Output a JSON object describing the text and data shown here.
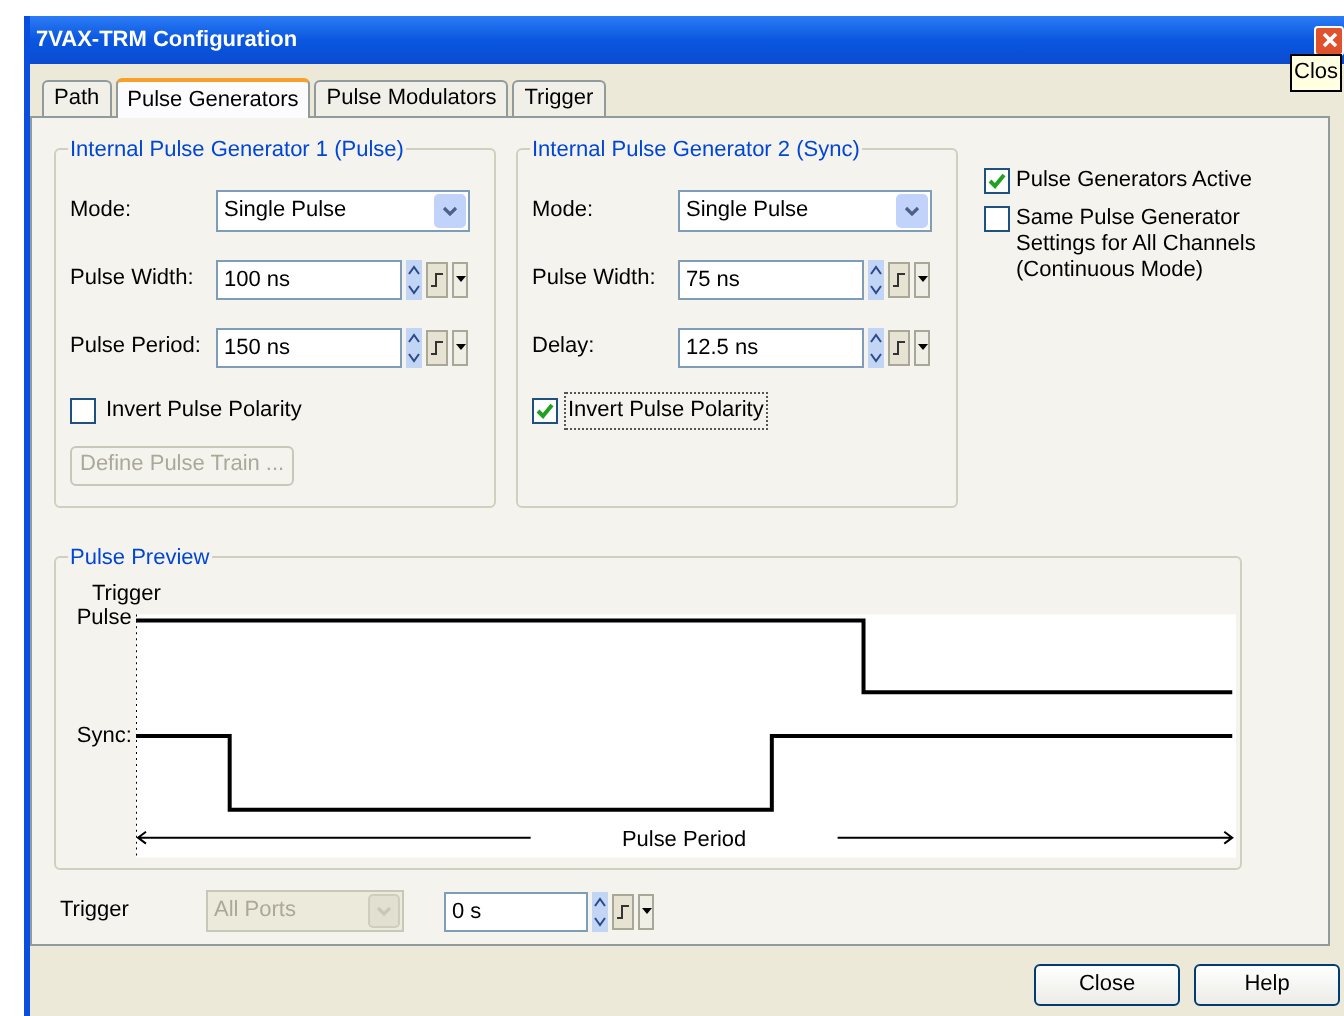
{
  "window": {
    "title": "7VAX-TRM Configuration",
    "close_tooltip": "Clos"
  },
  "tabs": [
    {
      "label": "Path",
      "selected": false
    },
    {
      "label": "Pulse Generators",
      "selected": true
    },
    {
      "label": "Pulse Modulators",
      "selected": false
    },
    {
      "label": "Trigger",
      "selected": false
    }
  ],
  "generators": [
    {
      "title": "Internal Pulse Generator 1 (Pulse)",
      "fields": [
        {
          "kind": "select",
          "label": "Mode:",
          "value": "Single Pulse"
        },
        {
          "kind": "spin",
          "label": "Pulse Width:",
          "value": "100 ns"
        },
        {
          "kind": "spin",
          "label": "Pulse Period:",
          "value": "150 ns"
        }
      ],
      "invert": {
        "label": "Invert Pulse Polarity",
        "checked": false,
        "focused": false
      },
      "button": {
        "label": "Define Pulse Train ...",
        "disabled": true
      }
    },
    {
      "title": "Internal Pulse Generator 2 (Sync)",
      "fields": [
        {
          "kind": "select",
          "label": "Mode:",
          "value": "Single Pulse"
        },
        {
          "kind": "spin",
          "label": "Pulse Width:",
          "value": "75 ns"
        },
        {
          "kind": "spin",
          "label": "Delay:",
          "value": "12.5 ns"
        }
      ],
      "invert": {
        "label": "Invert Pulse Polarity",
        "checked": true,
        "focused": true
      }
    }
  ],
  "options": [
    {
      "label": "Pulse Generators Active",
      "checked": true
    },
    {
      "label": "Same Pulse Generator Settings for All Channels (Continuous Mode)",
      "checked": false
    }
  ],
  "preview": {
    "title": "Pulse Preview",
    "trigger_label": "Trigger",
    "pulse_label": "Pulse",
    "sync_label": "Sync:",
    "period_label": "Pulse Period"
  },
  "trigger": {
    "label": "Trigger",
    "source": {
      "value": "All Ports",
      "disabled": true
    },
    "delay": "0 s"
  },
  "buttons": [
    "Close",
    "Help"
  ]
}
